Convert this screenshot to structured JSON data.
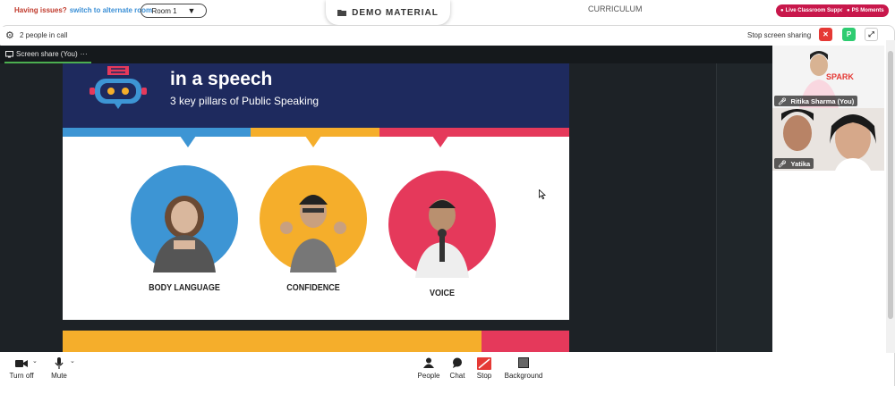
{
  "topbar": {
    "issues_label": "Having issues?",
    "switch_link": "switch to alternate room",
    "room_select": "Room 1",
    "demo_button": "DEMO MATERIAL",
    "curriculum_tab": "CURRICULUM",
    "live_support": "Live Classroom Support",
    "ps_moments": "PS Moments"
  },
  "callbar": {
    "people_count": "2 people in call",
    "stop_sharing": "Stop screen sharing",
    "participant_initial": "P"
  },
  "share": {
    "tab_label": "Screen share (You)",
    "more": "···"
  },
  "slide": {
    "title": "in a speech",
    "subtitle": "3 key pillars of Public Speaking",
    "pillars": [
      {
        "label": "BODY LANGUAGE",
        "color": "#3d95d4"
      },
      {
        "label": "CONFIDENCE",
        "color": "#f5ae2b"
      },
      {
        "label": "VOICE",
        "color": "#e5395b"
      }
    ]
  },
  "participants": [
    {
      "name": "Ritika Sharma (You)",
      "logo": "SPARK"
    },
    {
      "name": "Yatika"
    }
  ],
  "controls": {
    "turn_off": "Turn off",
    "mute": "Mute",
    "people": "People",
    "chat": "Chat",
    "stop": "Stop",
    "background": "Background"
  },
  "colors": {
    "accent_red": "#c8174b",
    "stop_red": "#e53935",
    "avatar_green": "#2ecc71",
    "slide_navy": "#1e2a5e"
  }
}
